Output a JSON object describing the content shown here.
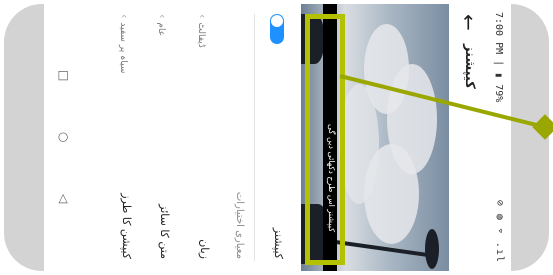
{
  "status_bar": {
    "time_battery": "7:00 PM | ▮ 79%",
    "icons": "⊘ ◍ ⌔ .ıl"
  },
  "app_bar": {
    "title": "کیپشنز"
  },
  "preview": {
    "caption": "کیپشنز اس طرح دکھائی دیں گی"
  },
  "settings": {
    "captions_label": "کیپشنز",
    "captions_enabled": true,
    "section_header": "معیاری اختیارات",
    "language_label": "زبان",
    "language_value": "ڈیفالٹ",
    "text_size_label": "متن کا سائز",
    "text_size_value": "عام",
    "caption_style_label": "کیپشن کا طرز",
    "caption_style_value": "سیاہ پر سفید"
  },
  "colors": {
    "toggle_on": "#1e90ff",
    "highlight": "#b3c100"
  }
}
